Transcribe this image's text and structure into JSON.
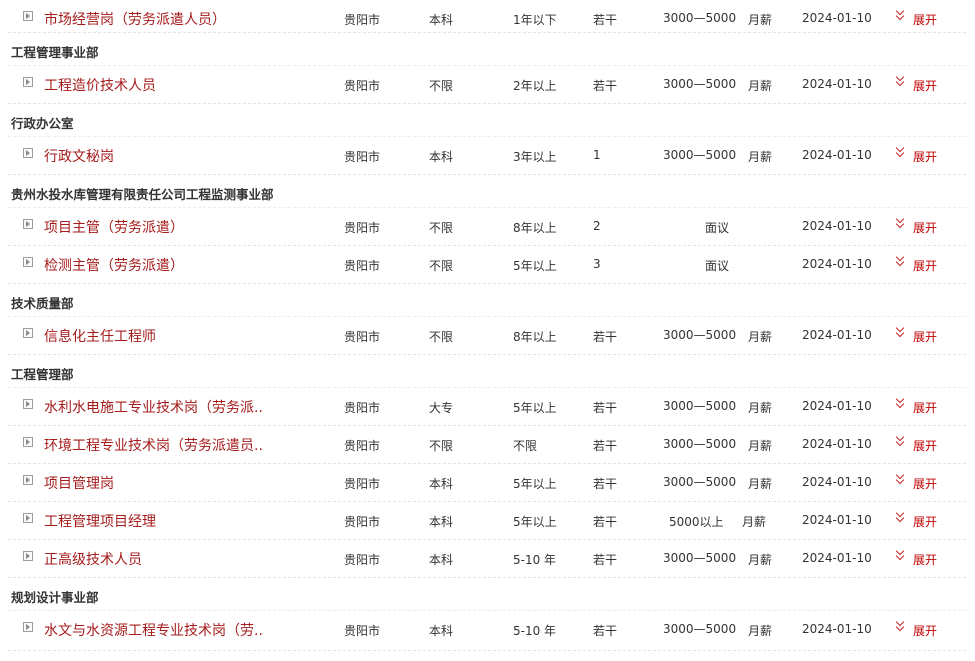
{
  "labels": {
    "expand": "展开"
  },
  "colors": {
    "title": "#a61c1c",
    "accent": "#c00000"
  },
  "icons": {
    "row_expand": "expand-box-icon",
    "toggle": "double-chevron-down-icon"
  },
  "rows": [
    {
      "kind": "job",
      "title": "市场经营岗（劳务派遣人员）",
      "location": "贵阳市",
      "education": "本科",
      "experience": "1年以下",
      "headcount": "若干",
      "salary": "3000—5000",
      "salary_unit": "月薪",
      "date": "2024-01-10"
    },
    {
      "kind": "dept",
      "name": "工程管理事业部"
    },
    {
      "kind": "job",
      "title": "工程造价技术人员",
      "location": "贵阳市",
      "education": "不限",
      "experience": "2年以上",
      "headcount": "若干",
      "salary": "3000—5000",
      "salary_unit": "月薪",
      "date": "2024-01-10"
    },
    {
      "kind": "dept",
      "name": "行政办公室"
    },
    {
      "kind": "job",
      "title": "行政文秘岗",
      "location": "贵阳市",
      "education": "本科",
      "experience": "3年以上",
      "headcount": "1",
      "salary": "3000—5000",
      "salary_unit": "月薪",
      "date": "2024-01-10"
    },
    {
      "kind": "dept",
      "name": "贵州水投水库管理有限责任公司工程监测事业部"
    },
    {
      "kind": "job",
      "title": "项目主管（劳务派遣）",
      "location": "贵阳市",
      "education": "不限",
      "experience": "8年以上",
      "headcount": "2",
      "salary": "面议",
      "salary_unit": "",
      "date": "2024-01-10"
    },
    {
      "kind": "job",
      "title": "检测主管（劳务派遣）",
      "location": "贵阳市",
      "education": "不限",
      "experience": "5年以上",
      "headcount": "3",
      "salary": "面议",
      "salary_unit": "",
      "date": "2024-01-10"
    },
    {
      "kind": "dept",
      "name": "技术质量部"
    },
    {
      "kind": "job",
      "title": "信息化主任工程师",
      "location": "贵阳市",
      "education": "不限",
      "experience": "8年以上",
      "headcount": "若干",
      "salary": "3000—5000",
      "salary_unit": "月薪",
      "date": "2024-01-10"
    },
    {
      "kind": "dept",
      "name": "工程管理部"
    },
    {
      "kind": "job",
      "title": "水利水电施工专业技术岗（劳务派..",
      "location": "贵阳市",
      "education": "大专",
      "experience": "5年以上",
      "headcount": "若干",
      "salary": "3000—5000",
      "salary_unit": "月薪",
      "date": "2024-01-10"
    },
    {
      "kind": "job",
      "title": "环境工程专业技术岗（劳务派遣员..",
      "location": "贵阳市",
      "education": "不限",
      "experience": "不限",
      "headcount": "若干",
      "salary": "3000—5000",
      "salary_unit": "月薪",
      "date": "2024-01-10"
    },
    {
      "kind": "job",
      "title": "项目管理岗",
      "location": "贵阳市",
      "education": "本科",
      "experience": "5年以上",
      "headcount": "若干",
      "salary": "3000—5000",
      "salary_unit": "月薪",
      "date": "2024-01-10"
    },
    {
      "kind": "job",
      "title": "工程管理项目经理",
      "location": "贵阳市",
      "education": "本科",
      "experience": "5年以上",
      "headcount": "若干",
      "salary": "5000以上",
      "salary_unit": "月薪",
      "date": "2024-01-10"
    },
    {
      "kind": "job",
      "title": "正高级技术人员",
      "location": "贵阳市",
      "education": "本科",
      "experience": "5-10 年",
      "headcount": "若干",
      "salary": "3000—5000",
      "salary_unit": "月薪",
      "date": "2024-01-10"
    },
    {
      "kind": "dept",
      "name": "规划设计事业部"
    },
    {
      "kind": "job",
      "title": "水文与水资源工程专业技术岗（劳..",
      "location": "贵阳市",
      "education": "本科",
      "experience": "5-10 年",
      "headcount": "若干",
      "salary": "3000—5000",
      "salary_unit": "月薪",
      "date": "2024-01-10"
    }
  ]
}
